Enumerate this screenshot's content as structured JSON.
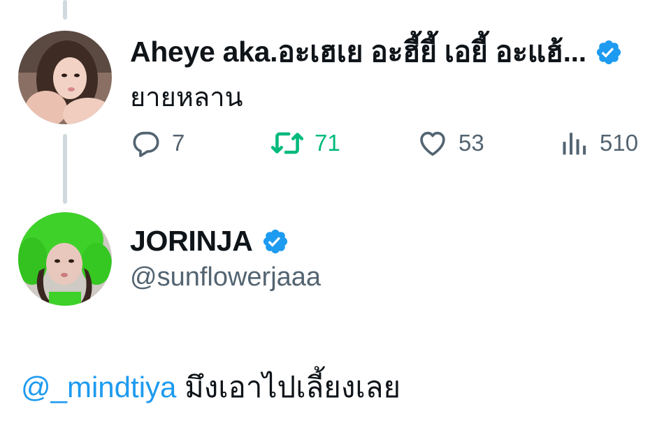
{
  "parent_tweet": {
    "author_name": "Aheye aka.อะเฮเย อะฮี้ยี้ เอยี้ อะแฮ้...",
    "verified_icon": "verified-badge-icon",
    "text": "ยายหลาน",
    "avatar_icon": "profile-avatar",
    "actions": {
      "reply_count": "7",
      "retweet_count": "71",
      "like_count": "53",
      "views_count": "510"
    }
  },
  "reply_tweet": {
    "author_name": "JORINJA",
    "verified_icon": "verified-badge-icon",
    "handle": "@sunflowerjaaa",
    "avatar_icon": "profile-avatar",
    "mention": "@_mindtiya",
    "text": "มึงเอาไปเลี้ยงเลย"
  },
  "colors": {
    "text": "#0f1419",
    "secondary": "#536471",
    "retweet_green": "#00ba7c",
    "link_blue": "#1d9bf0",
    "verified_blue": "#1d9bf0",
    "thread_line": "#cfd9de"
  }
}
